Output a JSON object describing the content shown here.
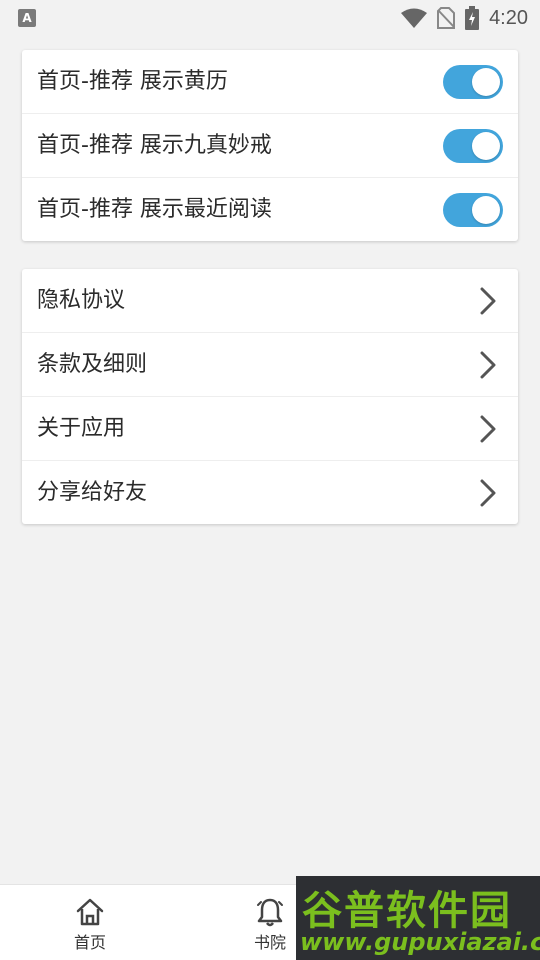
{
  "status_bar": {
    "left_icon_letter": "A",
    "time": "4:20"
  },
  "toggle_settings": [
    {
      "label": "首页-推荐 展示黄历",
      "enabled": true
    },
    {
      "label": "首页-推荐 展示九真妙戒",
      "enabled": true
    },
    {
      "label": "首页-推荐 展示最近阅读",
      "enabled": true
    }
  ],
  "links": [
    {
      "label": "隐私协议"
    },
    {
      "label": "条款及细则"
    },
    {
      "label": "关于应用"
    },
    {
      "label": "分享给好友"
    }
  ],
  "bottom_nav": {
    "home_label": "首页",
    "books_label": "书院"
  },
  "watermark": {
    "title": "谷普软件园",
    "url": "www.gupuxiazai.com"
  },
  "colors": {
    "toggle_on": "#42a5dc",
    "background": "#f2f2f2",
    "watermark_green": "#7bbf1e"
  },
  "icons": [
    "wifi-icon",
    "no-sim-icon",
    "battery-charging-icon",
    "chevron-right-icon",
    "home-icon",
    "bell-icon"
  ]
}
